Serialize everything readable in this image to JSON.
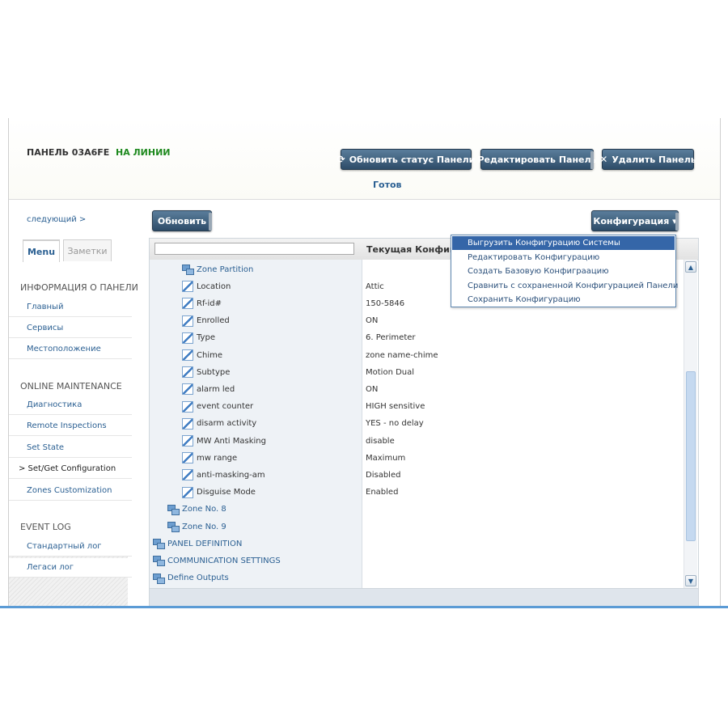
{
  "header": {
    "panel_name": "ПАНЕЛЬ 03A6FE",
    "panel_status": "НА ЛИНИИ",
    "refresh_status_button": "Обновить статус Панели",
    "edit_button": "Редактировать Панель",
    "delete_button": "Удалить Панель",
    "status_text": "Готов"
  },
  "sidebar": {
    "next_link": "следующий >",
    "tabs": [
      "Menu",
      "Заметки"
    ],
    "sections": [
      {
        "title": "ИНФОРМАЦИЯ О ПАНЕЛИ",
        "items": [
          "Главный",
          "Сервисы",
          "Местоположение"
        ]
      },
      {
        "title": "ONLINE MAINTENANCE",
        "items": [
          "Диагностика",
          "Remote Inspections",
          "Set State",
          "> Set/Get Configuration",
          "Zones Customization"
        ]
      },
      {
        "title": "EVENT LOG",
        "items": [
          "Стандартный лог",
          "Легаси лог"
        ]
      }
    ]
  },
  "toolbar": {
    "update_button": "Обновить",
    "config_button": "Конфигурация ▾"
  },
  "grid": {
    "column_title": "Текущая Конфигру",
    "rows": [
      {
        "label": "Zone Partition",
        "value": "",
        "type": "node"
      },
      {
        "label": "Location",
        "value": "Attic",
        "type": "leaf"
      },
      {
        "label": "Rf-id#",
        "value": "150-5846",
        "type": "leaf"
      },
      {
        "label": "Enrolled",
        "value": "ON",
        "type": "leaf"
      },
      {
        "label": "Type",
        "value": "6. Perimeter",
        "type": "leaf"
      },
      {
        "label": "Chime",
        "value": "zone name-chime",
        "type": "leaf"
      },
      {
        "label": "Subtype",
        "value": "Motion Dual",
        "type": "leaf"
      },
      {
        "label": "alarm led",
        "value": "ON",
        "type": "leaf"
      },
      {
        "label": "event counter",
        "value": "HIGH sensitive",
        "type": "leaf"
      },
      {
        "label": "disarm activity",
        "value": "YES - no delay",
        "type": "leaf"
      },
      {
        "label": "MW Anti Masking",
        "value": "disable",
        "type": "leaf"
      },
      {
        "label": "mw range",
        "value": "Maximum",
        "type": "leaf"
      },
      {
        "label": "anti-masking-am",
        "value": "Disabled",
        "type": "leaf"
      },
      {
        "label": "Disguise Mode",
        "value": "Enabled",
        "type": "leaf"
      },
      {
        "label": "Zone No. 8",
        "value": "",
        "type": "node"
      },
      {
        "label": "Zone No. 9",
        "value": "",
        "type": "node"
      },
      {
        "label": "PANEL DEFINITION",
        "value": "",
        "type": "node"
      },
      {
        "label": "COMMUNICATION SETTINGS",
        "value": "",
        "type": "node"
      },
      {
        "label": "Define Outputs",
        "value": "",
        "type": "node"
      }
    ]
  },
  "config_menu": {
    "items": [
      "Выгрузить Конфигурацию Системы",
      "Редактировать Конфигурацию",
      "Создать Базовую Конфиграацию",
      "Сравнить с сохраненной Конфигурацией Панели",
      "Сохранить Конфигурацию"
    ],
    "selected_index": 0
  }
}
